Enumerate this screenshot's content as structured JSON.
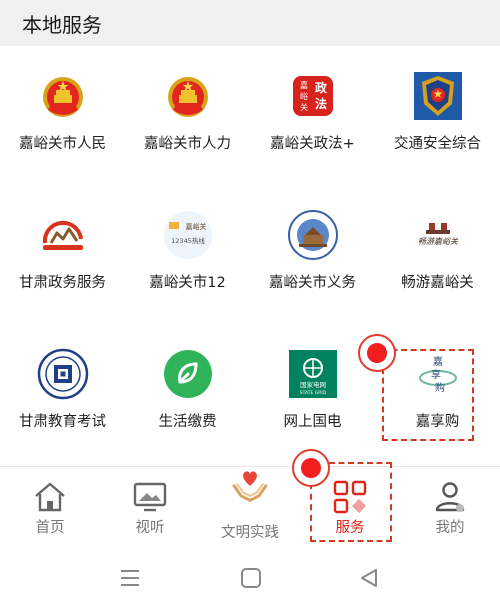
{
  "section": {
    "title": "本地服务"
  },
  "services": [
    {
      "label": "嘉峪关市人民",
      "icon": "national-emblem-icon"
    },
    {
      "label": "嘉峪关市人力",
      "icon": "national-emblem-icon"
    },
    {
      "label": "嘉峪关政法+",
      "icon": "politics-law-seal-icon",
      "seal_text": [
        "政",
        "法",
        "嘉",
        "峪",
        "关"
      ]
    },
    {
      "label": "交通安全综合",
      "icon": "police-badge-icon"
    },
    {
      "label": "甘肃政务服务",
      "icon": "gansu-gov-service-icon"
    },
    {
      "label": "嘉峪关市12",
      "icon": "hotline-12345-icon",
      "logo_text": [
        "嘉峪关",
        "12345热线"
      ]
    },
    {
      "label": "嘉峪关市义务",
      "icon": "fortress-seal-icon"
    },
    {
      "label": "畅游嘉峪关",
      "icon": "tourism-calligraphy-icon",
      "logo_text": "畅游嘉峪关"
    },
    {
      "label": "甘肃教育考试",
      "icon": "education-exam-seal-icon"
    },
    {
      "label": "生活缴费",
      "icon": "payment-leaf-icon"
    },
    {
      "label": "网上国电",
      "icon": "state-grid-icon",
      "logo_text": [
        "国家电网",
        "STATE GRID"
      ]
    },
    {
      "label": "嘉享购",
      "icon": "jiaxianggou-logo-icon",
      "logo_text": [
        "嘉",
        "享",
        "购"
      ]
    }
  ],
  "tabs": [
    {
      "label": "首页",
      "icon": "home-icon"
    },
    {
      "label": "视听",
      "icon": "tv-icon"
    },
    {
      "label": "文明实践",
      "icon": "heart-hands-icon"
    },
    {
      "label": "服务",
      "icon": "services-grid-icon"
    },
    {
      "label": "我的",
      "icon": "profile-icon"
    }
  ],
  "active_tab": "服务",
  "system_nav": [
    "menu-icon",
    "home-square-icon",
    "back-triangle-icon"
  ],
  "colors": {
    "accent_red": "#e2231a",
    "annotation": "#cf3b1f",
    "header_bg": "#f0f0f0",
    "tab_gray": "#777777"
  }
}
